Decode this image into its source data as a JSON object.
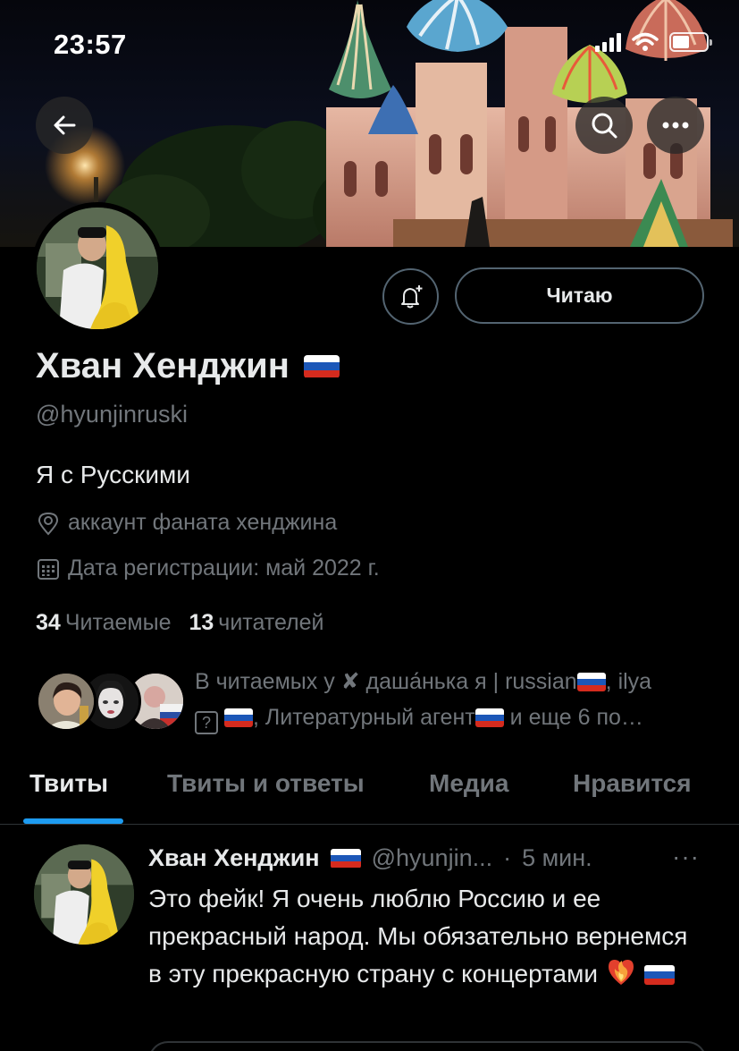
{
  "status_bar": {
    "time": "23:57",
    "battery_level": 0.5
  },
  "header": {
    "back_icon": "arrow-left-icon",
    "search_icon": "search-icon",
    "more_icon": "more-horizontal-icon",
    "banner": "St. Basil's Cathedral at night"
  },
  "profile": {
    "display_name": "Хван Хенджин",
    "name_emoji": "russia-flag",
    "handle": "@hyunjinruski",
    "bio": "Я с Русскими",
    "location": "аккаунт фаната хенджина",
    "joined": "Дата регистрации: май 2022 г.",
    "following_count": "34",
    "following_label": "Читаемые",
    "followers_count": "13",
    "followers_label": "читателей",
    "follow_button_label": "Читаю"
  },
  "known_followers": {
    "text_before": "В читаемых у ✘ даша́нька я | russian",
    "text_between_1": ", ilya",
    "placeholder_glyph": "?",
    "text_between_2": ", Литературный агент",
    "text_after": " и еще 6 по…"
  },
  "tabs": [
    {
      "label": "Твиты",
      "active": true
    },
    {
      "label": "Твиты и ответы",
      "active": false
    },
    {
      "label": "Медиа",
      "active": false
    },
    {
      "label": "Нравится",
      "active": false
    }
  ],
  "tweet": {
    "author_name": "Хван Хенджин",
    "author_handle": "@hyunjin...",
    "dot": "·",
    "time": "5 мин.",
    "more": "···",
    "text": "Это фейк! Я очень люблю Россию и ее прекрасный народ. Мы обязательно вернемся в эту прекрасную страну с концертами"
  },
  "colors": {
    "background": "#000000",
    "primary_text": "#e7e9ea",
    "secondary_text": "#71767b",
    "accent": "#1d9bf0",
    "border": "#2f3336"
  }
}
